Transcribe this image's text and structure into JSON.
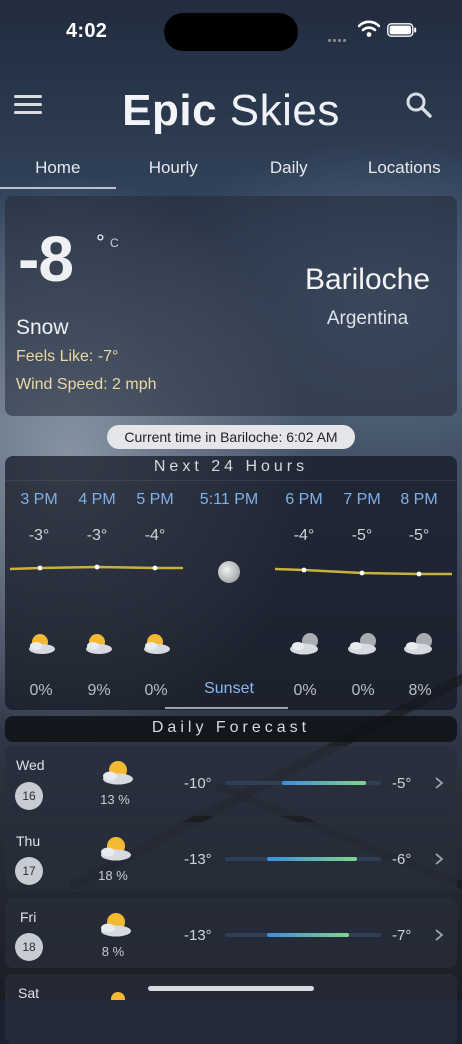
{
  "status": {
    "time": "4:02"
  },
  "header": {
    "title_bold": "Epic",
    "title_light": "Skies"
  },
  "tabs": [
    {
      "label": "Home",
      "active": true
    },
    {
      "label": "Hourly",
      "active": false
    },
    {
      "label": "Daily",
      "active": false
    },
    {
      "label": "Locations",
      "active": false
    }
  ],
  "current": {
    "temp": "-8",
    "degree_symbol": "°",
    "unit": "C",
    "condition": "Snow",
    "feels_like": "Feels Like: -7°",
    "wind_speed": "Wind Speed: 2 mph",
    "city": "Bariloche",
    "country": "Argentina",
    "local_time": "Current time in Bariloche: 6:02 AM"
  },
  "hourly": {
    "title": "Next 24 Hours",
    "sunset_time": "5:11 PM",
    "sunset_label": "Sunset",
    "hours": [
      {
        "time": "3 PM",
        "temp": "-3°",
        "precip": "0%",
        "icon": "partly-sunny-icon"
      },
      {
        "time": "4 PM",
        "temp": "-3°",
        "precip": "9%",
        "icon": "partly-sunny-icon"
      },
      {
        "time": "5 PM",
        "temp": "-4°",
        "precip": "0%",
        "icon": "partly-sunny-icon"
      },
      {
        "time": "6 PM",
        "temp": "-4°",
        "precip": "0%",
        "icon": "partly-cloudy-night-icon"
      },
      {
        "time": "7 PM",
        "temp": "-5°",
        "precip": "0%",
        "icon": "partly-cloudy-night-icon"
      },
      {
        "time": "8 PM",
        "temp": "-5°",
        "precip": "8%",
        "icon": "partly-cloudy-night-icon"
      }
    ],
    "colors": {
      "time": "#7fb1ea",
      "trend_line": "#c8b23c"
    }
  },
  "daily": {
    "title": "Daily Forecast",
    "days": [
      {
        "day": "Wed",
        "date": "16",
        "precip": "13 %",
        "low": "-10°",
        "high": "-5°",
        "icon": "partly-sunny-icon"
      },
      {
        "day": "Thu",
        "date": "17",
        "precip": "18 %",
        "low": "-13°",
        "high": "-6°",
        "icon": "partly-sunny-icon"
      },
      {
        "day": "Fri",
        "date": "18",
        "precip": "8 %",
        "low": "-13°",
        "high": "-7°",
        "icon": "partly-sunny-icon"
      },
      {
        "day": "Sat",
        "date": "",
        "precip": "",
        "low": "",
        "high": "",
        "icon": "partly-sunny-icon"
      }
    ]
  }
}
